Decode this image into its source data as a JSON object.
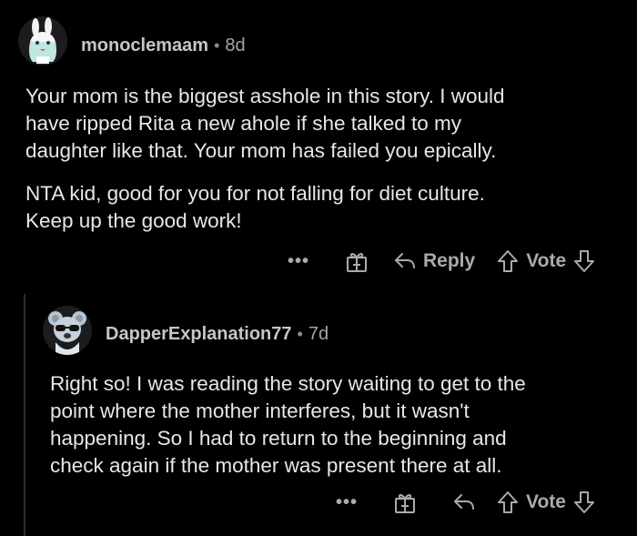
{
  "comments": [
    {
      "username": "monoclemaam",
      "separator": "•",
      "age": "8d",
      "paragraphs": [
        "Your mom is the biggest asshole in this story. I would\nhave ripped Rita a new ahole if she talked to my\ndaughter like that. Your mom has failed you epically.",
        "NTA kid, good for you for not falling for diet culture.\nKeep up the good work!"
      ],
      "more_label": "•••",
      "reply_label": "Reply",
      "vote_label": "Vote"
    },
    {
      "username": "DapperExplanation77",
      "separator": "•",
      "age": "7d",
      "paragraphs": [
        "Right so! I was reading the story waiting to get to the\npoint where the mother interferes, but it wasn't\nhappening. So I had to return to the beginning and\ncheck again if the mother was present there at all."
      ],
      "more_label": "•••",
      "reply_label": "",
      "vote_label": "Vote"
    }
  ],
  "icons": {
    "avatar1": "white-bunny-character-avatar",
    "avatar2": "koala-with-sunglasses-avatar",
    "gift": "gift-award-icon",
    "reply": "reply-arrow-icon",
    "upvote": "upvote-arrow-icon",
    "downvote": "downvote-arrow-icon"
  },
  "colors": {
    "background": "#000000",
    "text": "#e6e7e8",
    "muted": "#a8abad"
  }
}
